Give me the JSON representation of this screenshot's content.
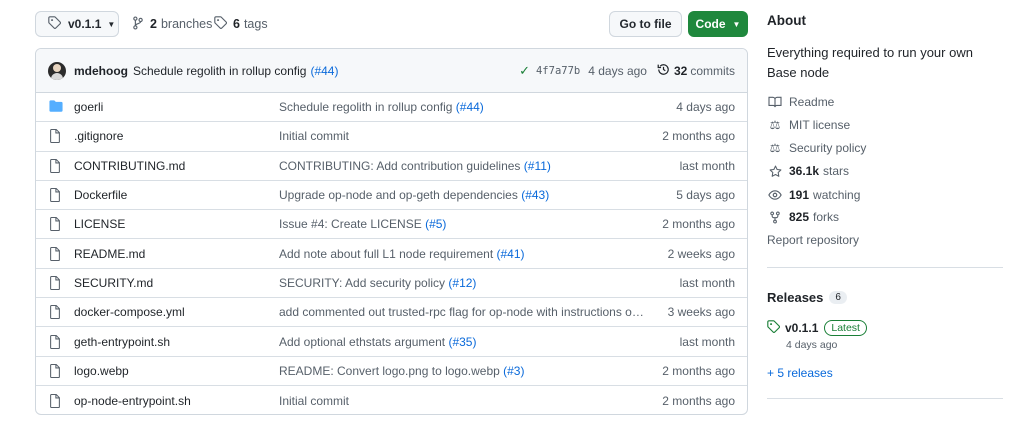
{
  "topbar": {
    "branch": "v0.1.1",
    "branches_count": "2",
    "branches_label": "branches",
    "tags_count": "6",
    "tags_label": "tags",
    "goto_label": "Go to file",
    "code_label": "Code"
  },
  "commit": {
    "author": "mdehoog",
    "message": "Schedule regolith in rollup config",
    "pr": "(#44)",
    "sha": "4f7a77b",
    "age": "4 days ago",
    "commits_count": "32",
    "commits_label": "commits"
  },
  "files": [
    {
      "name": "goerli",
      "type": "folder",
      "msg": "Schedule regolith in rollup config ",
      "link": "(#44)",
      "age": "4 days ago"
    },
    {
      "name": ".gitignore",
      "type": "file",
      "msg": "Initial commit",
      "link": "",
      "age": "2 months ago"
    },
    {
      "name": "CONTRIBUTING.md",
      "type": "file",
      "msg": "CONTRIBUTING: Add contribution guidelines ",
      "link": "(#11)",
      "age": "last month"
    },
    {
      "name": "Dockerfile",
      "type": "file",
      "msg": "Upgrade op-node and op-geth dependencies ",
      "link": "(#43)",
      "age": "5 days ago"
    },
    {
      "name": "LICENSE",
      "type": "file",
      "msg": "Issue #4: Create LICENSE ",
      "link": "(#5)",
      "age": "2 months ago"
    },
    {
      "name": "README.md",
      "type": "file",
      "msg": "Add note about full L1 node requirement ",
      "link": "(#41)",
      "age": "2 weeks ago"
    },
    {
      "name": "SECURITY.md",
      "type": "file",
      "msg": "SECURITY: Add security policy ",
      "link": "(#12)",
      "age": "last month"
    },
    {
      "name": "docker-compose.yml",
      "type": "file",
      "msg": "add commented out trusted-rpc flag for op-node with instructions on w...",
      "link": "",
      "age": "3 weeks ago"
    },
    {
      "name": "geth-entrypoint.sh",
      "type": "file",
      "msg": "Add optional ethstats argument ",
      "link": "(#35)",
      "age": "last month"
    },
    {
      "name": "logo.webp",
      "type": "file",
      "msg": "README: Convert logo.png to logo.webp ",
      "link": "(#3)",
      "age": "2 months ago"
    },
    {
      "name": "op-node-entrypoint.sh",
      "type": "file",
      "msg": "Initial commit",
      "link": "",
      "age": "2 months ago"
    }
  ],
  "about": {
    "title": "About",
    "description": "Everything required to run your own Base node",
    "readme": "Readme",
    "license": "MIT license",
    "security": "Security policy",
    "stars_count": "36.1k",
    "stars_label": "stars",
    "watching_count": "191",
    "watching_label": "watching",
    "forks_count": "825",
    "forks_label": "forks",
    "report": "Report repository"
  },
  "releases": {
    "title": "Releases",
    "count": "6",
    "latest_name": "v0.1.1",
    "latest_badge": "Latest",
    "latest_date": "4 days ago",
    "more": "+ 5 releases"
  },
  "colors": {
    "link": "#0969da",
    "code_button": "#1f883d",
    "success": "#1a7f37",
    "folder": "#54aeff"
  }
}
